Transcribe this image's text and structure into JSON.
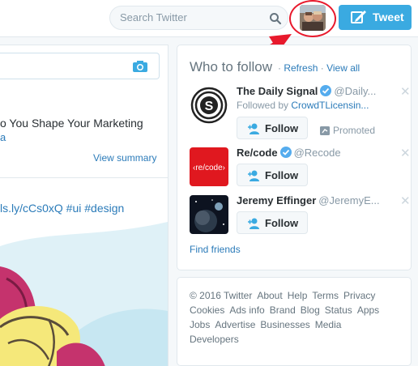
{
  "header": {
    "search_placeholder": "Search Twitter",
    "tweet_label": "Tweet"
  },
  "timeline": {
    "card_title": "o You Shape Your Marketing",
    "card_link": "a",
    "view_summary": "View summary",
    "tweet_text": "ls.ly/cCs0xQ #ui #design"
  },
  "who_to_follow": {
    "title": "Who to follow",
    "separator": "·",
    "refresh": "Refresh",
    "view_all": "View all",
    "suggestions": [
      {
        "name": "The Daily Signal",
        "handle": "@Daily...",
        "followed_by_prefix": "Followed by",
        "followed_by": "CrowdTLicensin...",
        "follow_label": "Follow",
        "promoted_label": "Promoted",
        "avatar_text": "S"
      },
      {
        "name": "Re/code",
        "handle": "@Recode",
        "follow_label": "Follow",
        "avatar_text": "‹re/code›"
      },
      {
        "name": "Jeremy Effinger",
        "handle": "@JeremyE...",
        "follow_label": "Follow"
      }
    ],
    "find_friends": "Find friends"
  },
  "footer": {
    "links": [
      "© 2016 Twitter",
      "About",
      "Help",
      "Terms",
      "Privacy",
      "Cookies",
      "Ads info",
      "Brand",
      "Blog",
      "Status",
      "Apps",
      "Jobs",
      "Advertise",
      "Businesses",
      "Media",
      "Developers"
    ]
  },
  "colors": {
    "accent": "#3aaae1",
    "link": "#2b7bb9",
    "annotation": "#e8192c"
  }
}
